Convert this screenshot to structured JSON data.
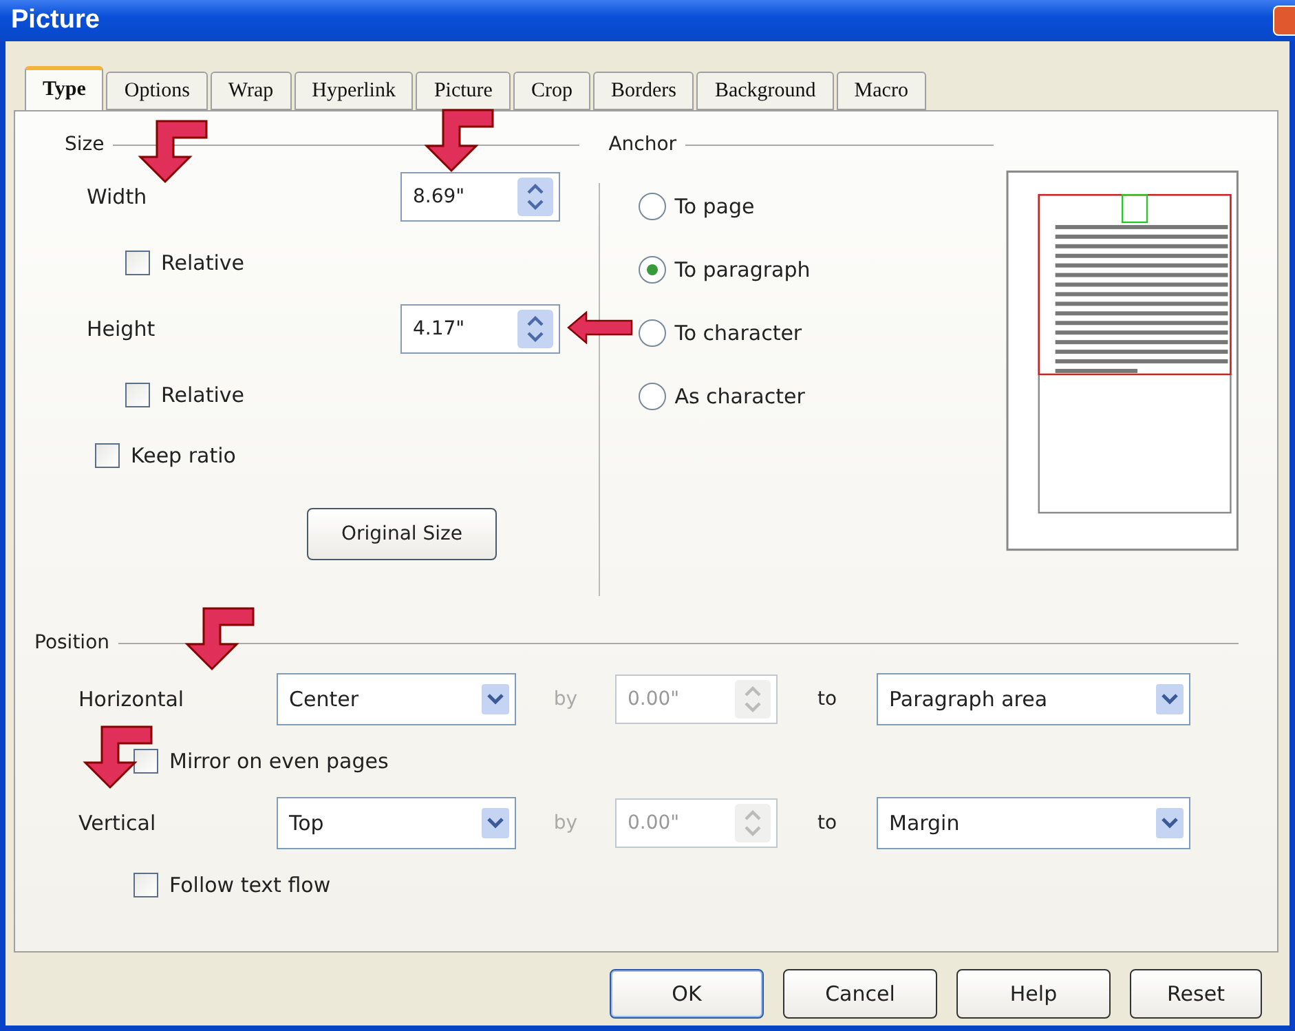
{
  "window": {
    "title": "Picture"
  },
  "tabs": [
    {
      "label": "Type",
      "selected": true
    },
    {
      "label": "Options",
      "selected": false
    },
    {
      "label": "Wrap",
      "selected": false
    },
    {
      "label": "Hyperlink",
      "selected": false
    },
    {
      "label": "Picture",
      "selected": false
    },
    {
      "label": "Crop",
      "selected": false
    },
    {
      "label": "Borders",
      "selected": false
    },
    {
      "label": "Background",
      "selected": false
    },
    {
      "label": "Macro",
      "selected": false
    }
  ],
  "size": {
    "title": "Size",
    "fields": [
      {
        "label": "Width",
        "value": "8.69\"",
        "relative": {
          "label": "Relative",
          "checked": false
        }
      },
      {
        "label": "Height",
        "value": "4.17\"",
        "relative": {
          "label": "Relative",
          "checked": false
        }
      }
    ],
    "keep_ratio": {
      "label": "Keep ratio",
      "checked": false
    },
    "original_size_button": "Original Size"
  },
  "anchor": {
    "title": "Anchor",
    "options": [
      {
        "label": "To page",
        "selected": false
      },
      {
        "label": "To paragraph",
        "selected": true
      },
      {
        "label": "To character",
        "selected": false
      },
      {
        "label": "As character",
        "selected": false
      }
    ]
  },
  "position": {
    "title": "Position",
    "rows": [
      {
        "label": "Horizontal",
        "value": "Center",
        "by_label": "by",
        "by_value": "0.00\"",
        "to_label": "to",
        "to_value": "Paragraph area",
        "option": {
          "label": "Mirror on even pages",
          "checked": false
        }
      },
      {
        "label": "Vertical",
        "value": "Top",
        "by_label": "by",
        "by_value": "0.00\"",
        "to_label": "to",
        "to_value": "Margin",
        "option": {
          "label": "Follow text flow",
          "checked": false
        }
      }
    ]
  },
  "buttons": [
    "OK",
    "Cancel",
    "Help",
    "Reset"
  ]
}
